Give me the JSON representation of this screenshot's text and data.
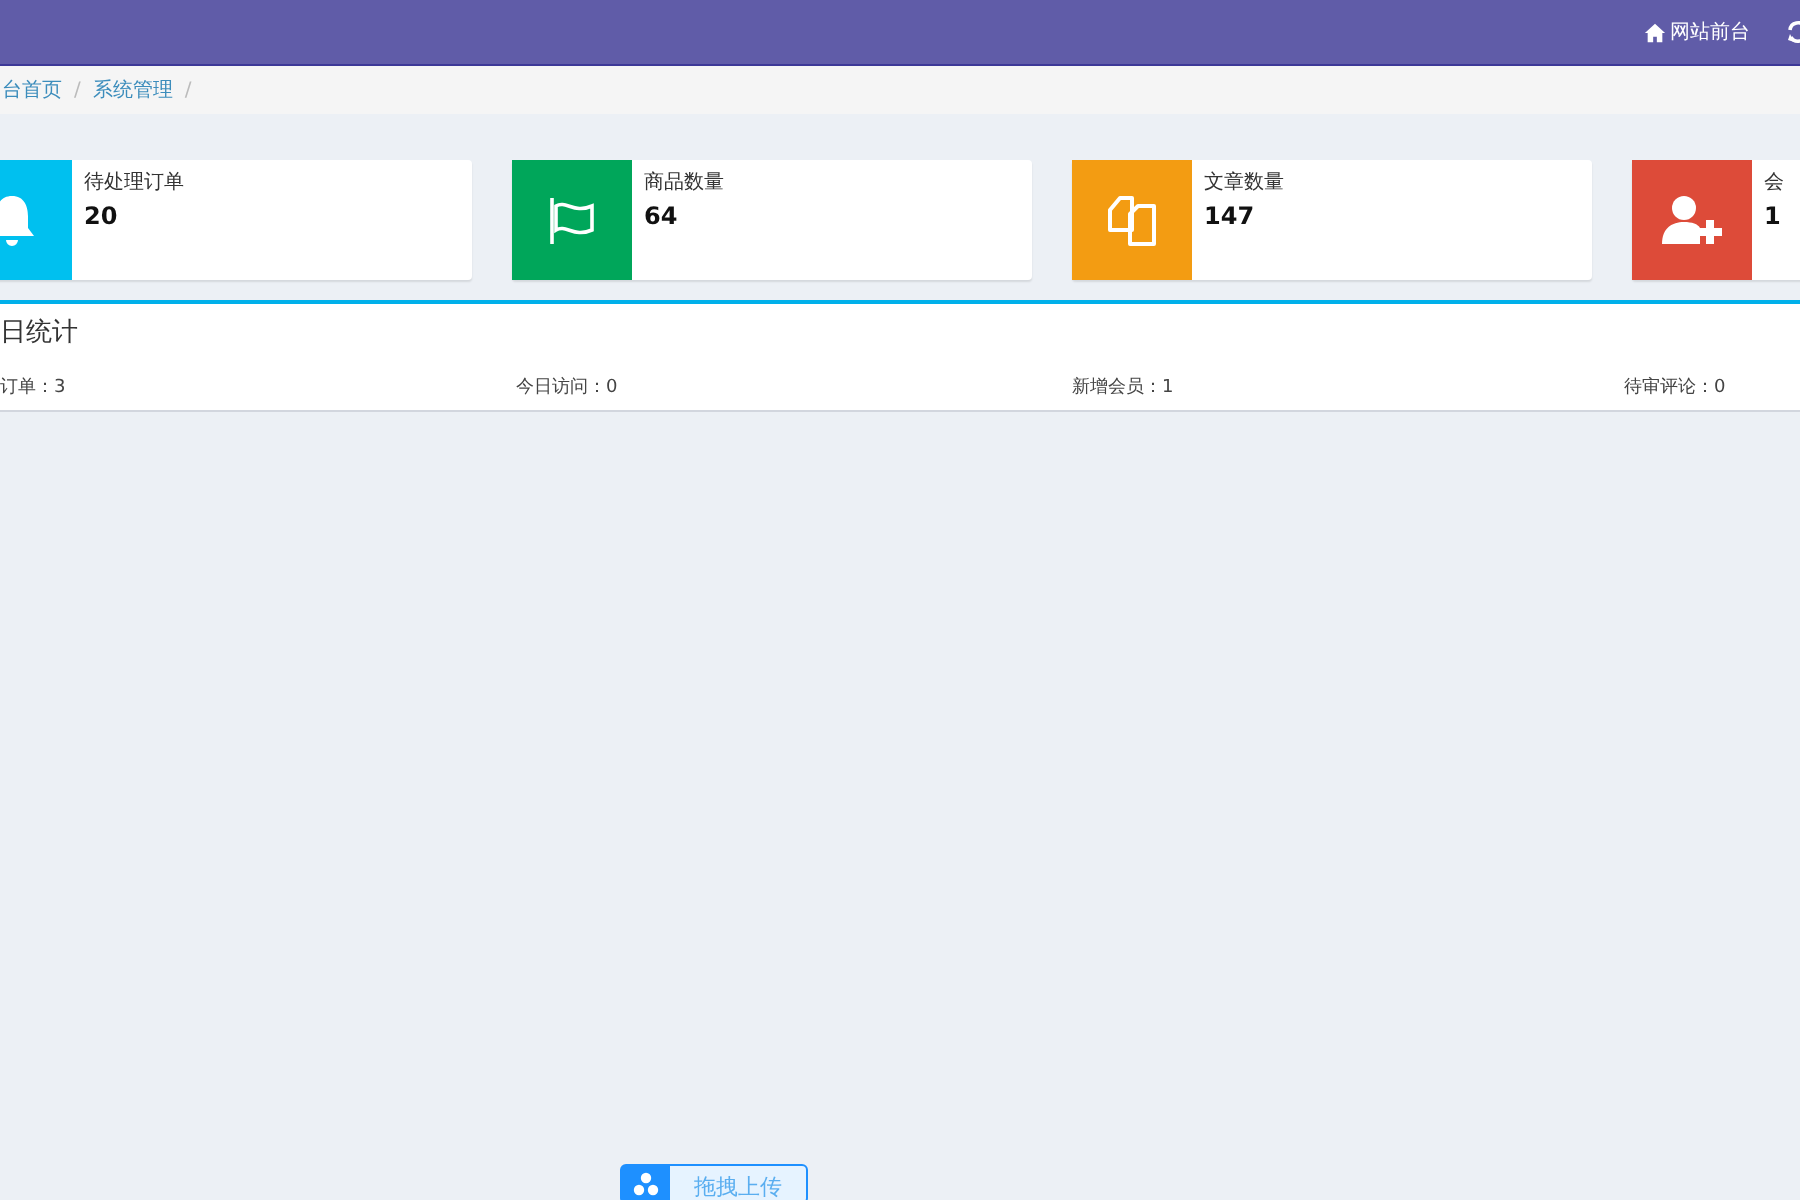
{
  "topbar": {
    "links": [
      {
        "label": "网站前台",
        "kind": "home"
      },
      {
        "kind": "refresh"
      }
    ]
  },
  "breadcrumb": [
    {
      "label": "台首页",
      "separator": "/"
    },
    {
      "label": "系统管理",
      "separator": "/"
    }
  ],
  "cards": [
    {
      "label": "待处理订单",
      "value": "20",
      "color": "#00c0ef",
      "kind": "bell"
    },
    {
      "label": "商品数量",
      "value": "64",
      "color": "#00a65a",
      "kind": "flag"
    },
    {
      "label": "文章数量",
      "value": "147",
      "color": "#f39c12",
      "kind": "files"
    },
    {
      "label": "会",
      "value": "1",
      "color": "#dd4b39",
      "kind": "user-add"
    }
  ],
  "stats": {
    "title": "日统计",
    "items": [
      "订单：3",
      "今日访问：0",
      "新增会员：1",
      "待审评论：0"
    ]
  },
  "upload_button": {
    "label": "拖拽上传"
  }
}
